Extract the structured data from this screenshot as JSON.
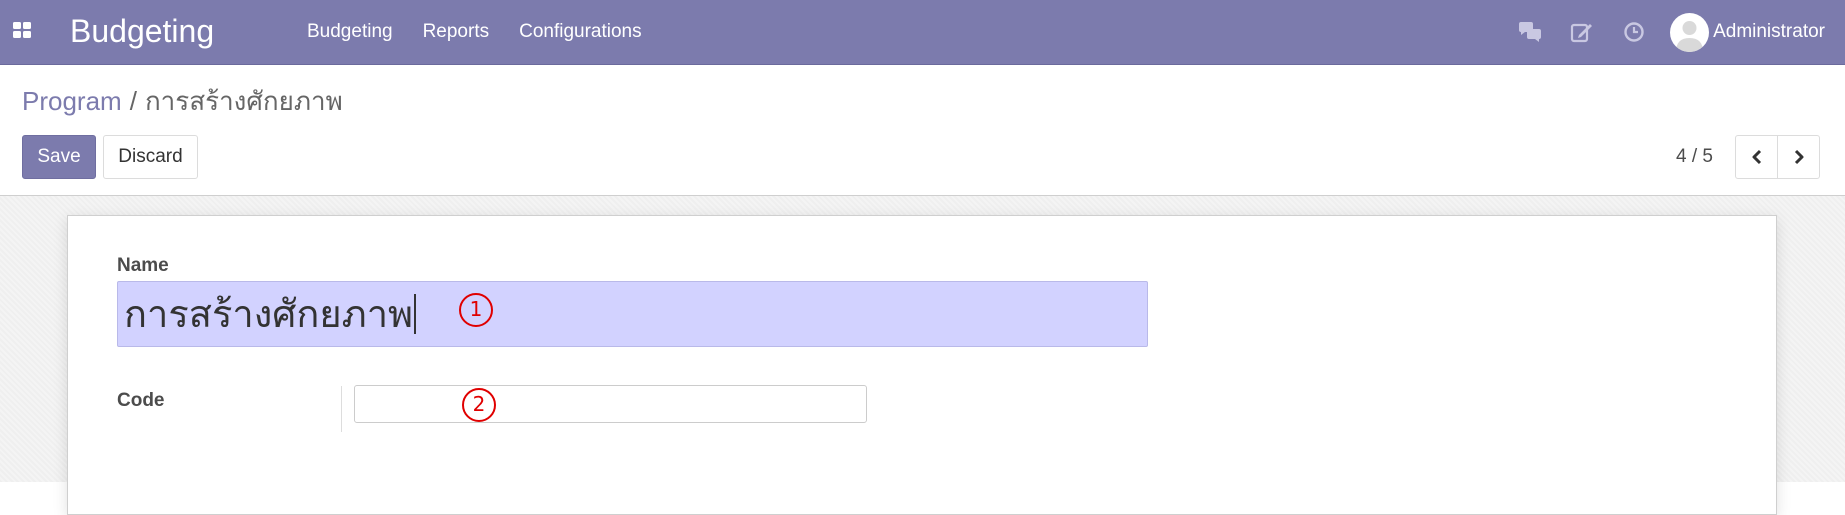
{
  "app": {
    "title": "Budgeting",
    "menu": [
      "Budgeting",
      "Reports",
      "Configurations"
    ],
    "user": "Administrator",
    "systray_icons": [
      "chat-icon",
      "edit-icon",
      "clock-icon"
    ]
  },
  "breadcrumb": {
    "parent": "Program",
    "separator": "/",
    "current": "การสร้างศักยภาพ"
  },
  "buttons": {
    "save": "Save",
    "discard": "Discard"
  },
  "pager": {
    "value": "4 / 5"
  },
  "form": {
    "name_label": "Name",
    "name_value": "การสร้างศักยภาพ",
    "code_label": "Code",
    "code_value": ""
  },
  "annotations": {
    "marker_1": "1",
    "marker_2": "2"
  },
  "colors": {
    "brand": "#7c7bad",
    "name_field_bg": "#d2d2ff",
    "annotation": "#e00000"
  }
}
